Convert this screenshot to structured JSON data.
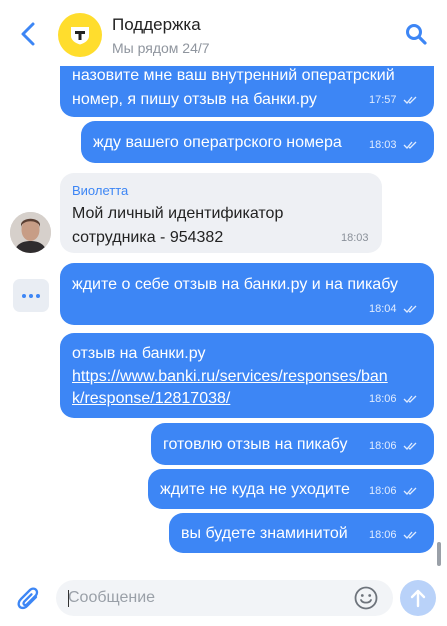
{
  "header": {
    "title": "Поддержка",
    "subtitle": "Мы рядом 24/7"
  },
  "messages": [
    {
      "direction": "outgoing",
      "lines": [
        "назовите мне ваш внутренний оператрский",
        "номер, я пишу отзыв на банки.ру"
      ],
      "time": "17:57",
      "read": true
    },
    {
      "direction": "outgoing",
      "lines": [
        "жду вашего оператрского номера"
      ],
      "time": "18:03",
      "read": true
    },
    {
      "direction": "incoming",
      "sender": "Виолетта",
      "lines": [
        "Мой личный идентификатор",
        "сотрудника - 954382"
      ],
      "time": "18:03"
    },
    {
      "direction": "outgoing",
      "lines": [
        "ждите о себе отзыв на банки.ру и на пикабу"
      ],
      "time": "18:04",
      "read": true
    },
    {
      "direction": "outgoing",
      "lines": [
        "отзыв на банки.ру"
      ],
      "link_lines": [
        "https://www.banki.ru/services/responses/ban",
        "k/response/12817038/"
      ],
      "time": "18:06",
      "read": true
    },
    {
      "direction": "outgoing",
      "lines": [
        "готовлю отзыв на пикабу"
      ],
      "time": "18:06",
      "read": true
    },
    {
      "direction": "outgoing",
      "lines": [
        "ждите не куда не уходите"
      ],
      "time": "18:06",
      "read": true
    },
    {
      "direction": "outgoing",
      "lines": [
        "вы будете знаминитой"
      ],
      "time": "18:06",
      "read": true
    }
  ],
  "composer": {
    "placeholder": "Сообщение"
  },
  "icons": {
    "back": "chevron-left-icon",
    "logo": "bank-shield-logo",
    "search": "search-icon",
    "attach": "paperclip-icon",
    "emoji": "smiley-icon",
    "send": "arrow-up-icon",
    "more": "more-dots-icon",
    "read": "double-check-icon"
  },
  "colors": {
    "accent": "#3d86f5",
    "brand_yellow": "#ffdd2d",
    "incoming_bubble": "#eef0f4"
  }
}
